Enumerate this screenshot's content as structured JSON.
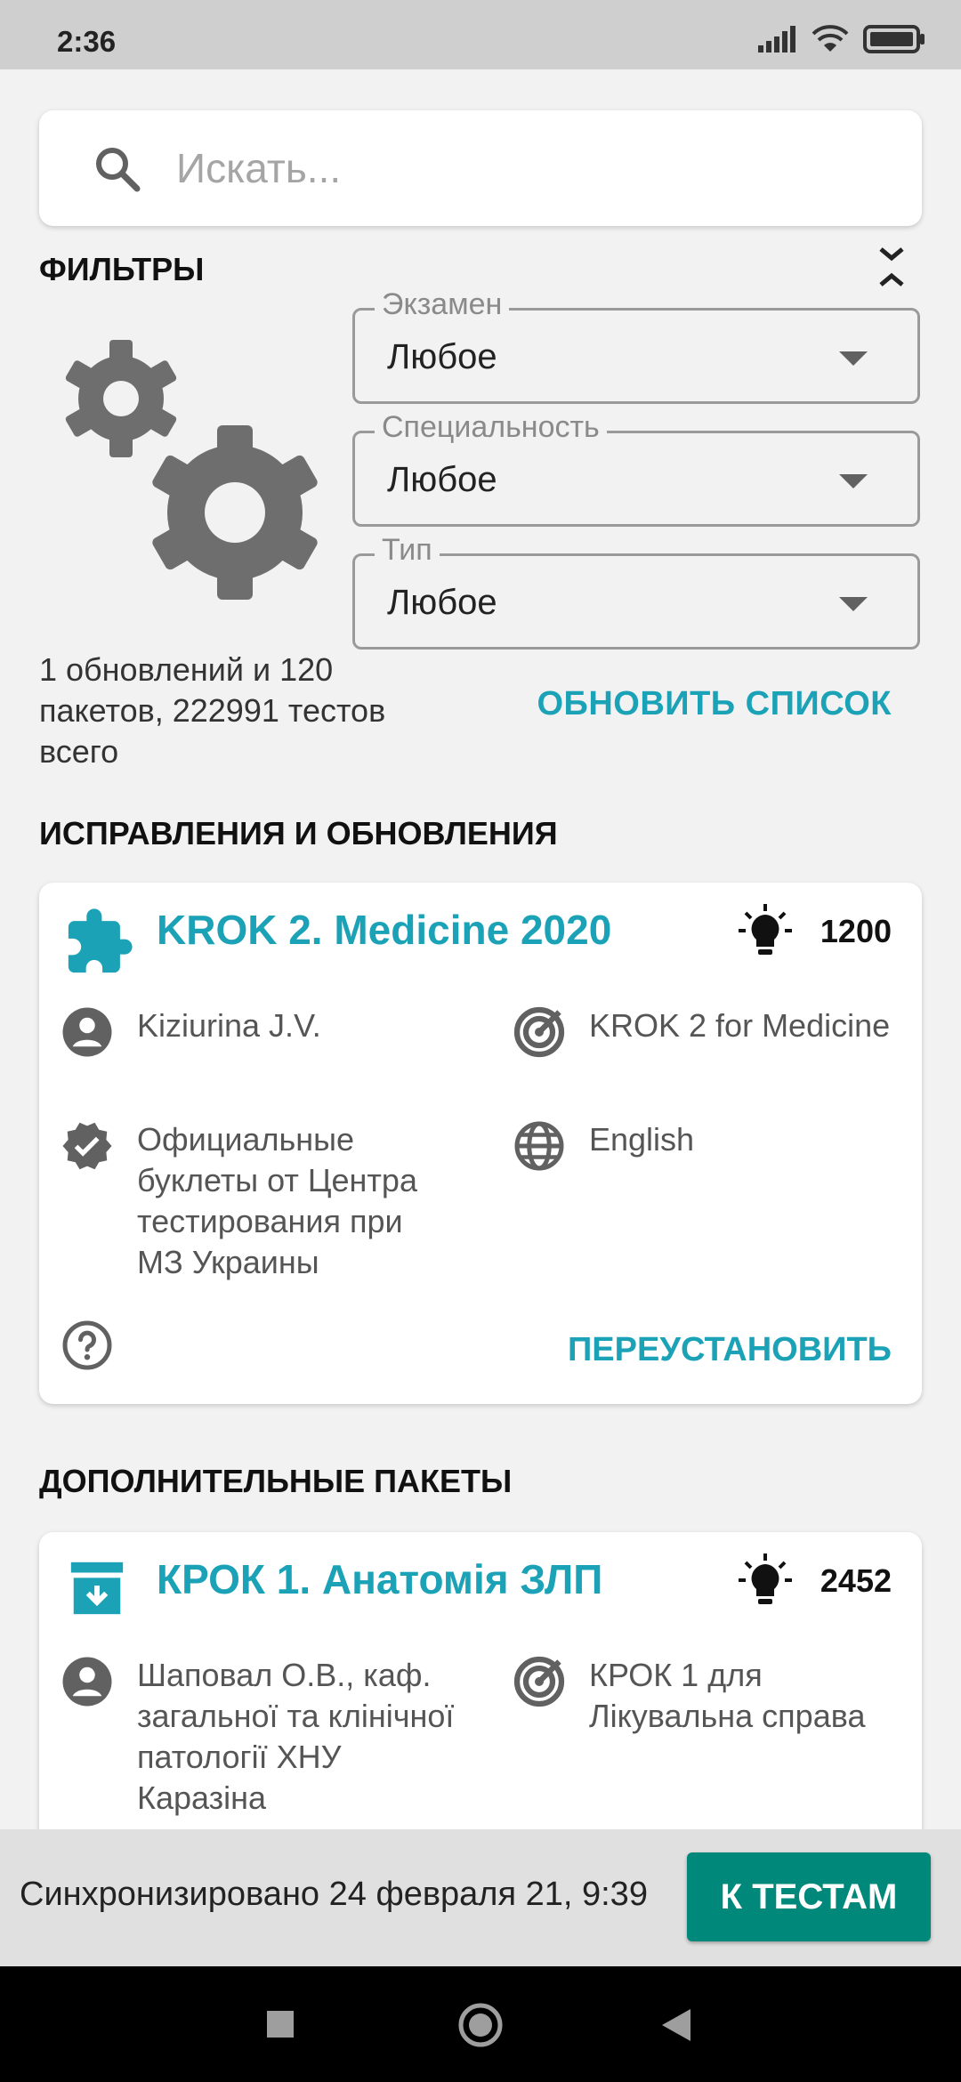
{
  "status_bar": {
    "time": "2:36"
  },
  "search": {
    "placeholder": "Искать..."
  },
  "filters": {
    "title": "ФИЛЬТРЫ",
    "dropdowns": [
      {
        "label": "Экзамен",
        "value": "Любое"
      },
      {
        "label": "Специальность",
        "value": "Любое"
      },
      {
        "label": "Тип",
        "value": "Любое"
      }
    ],
    "summary": "1 обновлений и 120 пакетов, 222991 тестов всего",
    "refresh_label": "ОБНОВИТЬ СПИСОК"
  },
  "updates_section": {
    "title": "ИСПРАВЛЕНИЯ И ОБНОВЛЕНИЯ",
    "card": {
      "title": "KROK 2. Medicine 2020",
      "count": "1200",
      "author": "Kiziurina J.V.",
      "target": "KROK 2 for Medicine",
      "source": "Официальные буклеты от Центра тестирования при МЗ Украины",
      "language": "English",
      "action_label": "ПЕРЕУСТАНОВИТЬ",
      "icon": "puzzle-icon"
    }
  },
  "packages_section": {
    "title": "ДОПОЛНИТЕЛЬНЫЕ ПАКЕТЫ",
    "card": {
      "title": "КРОК 1. Анатомія ЗЛП",
      "count": "2452",
      "author": "Шаповал О.В., каф. загальної та клінічної патології ХНУ Каразіна",
      "target": "КРОК 1 для Лікувальна справа",
      "icon": "archive-download-icon"
    }
  },
  "bottom_bar": {
    "sync_text": "Синхронизировано 24 февраля 21, 9:39",
    "button_label": "К ТЕСТАМ"
  },
  "colors": {
    "accent": "#1ba2b7",
    "primary_button": "#00897b",
    "background": "#f2f2f2"
  }
}
